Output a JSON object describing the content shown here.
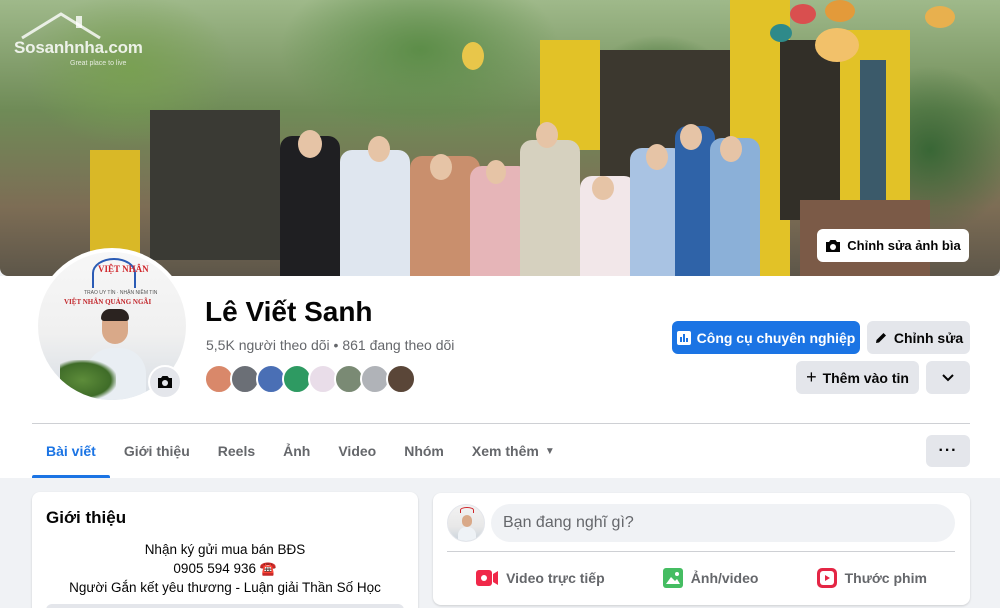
{
  "watermark": {
    "main": "Sosanhnha.com",
    "sub": "Great place to live"
  },
  "cover": {
    "edit_label": "Chỉnh sửa ảnh bìa"
  },
  "avatar": {
    "brand": "VIỆT NHÂN",
    "tagline": "TRAO UY TÍN · NHẬN NIỀM TIN",
    "subbrand": "VIỆT NHÂN QUẢNG NGÃI"
  },
  "profile": {
    "name": "Lê Viết Sanh",
    "stats": "5,5K người theo dõi • 861 đang theo dõi"
  },
  "actions": {
    "pro_tools": "Công cụ chuyên nghiệp",
    "edit": "Chỉnh sửa",
    "add_story": "Thêm vào tin"
  },
  "tabs": [
    "Bài viết",
    "Giới thiệu",
    "Reels",
    "Ảnh",
    "Video",
    "Nhóm",
    "Xem thêm"
  ],
  "intro": {
    "title": "Giới thiệu",
    "lines": [
      "Nhận ký gửi mua bán BĐS",
      "0905 594 936 ☎️",
      "Người Gắn kết yêu thương - Luận giải Thần Số Học"
    ]
  },
  "composer": {
    "placeholder": "Bạn đang nghĩ gì?",
    "live": "Video trực tiếp",
    "photo": "Ảnh/video",
    "reel": "Thước phim"
  },
  "colors": {
    "primary": "#1b74e4",
    "live": "#f02849",
    "photo": "#45bd62",
    "reel": "#e42645"
  },
  "friend_colors": [
    "#d9886a",
    "#6b6f76",
    "#4a6fb5",
    "#2e9a62",
    "#c9b7c9",
    "#7a8a74",
    "#9aa0a6",
    "#5a4638"
  ]
}
